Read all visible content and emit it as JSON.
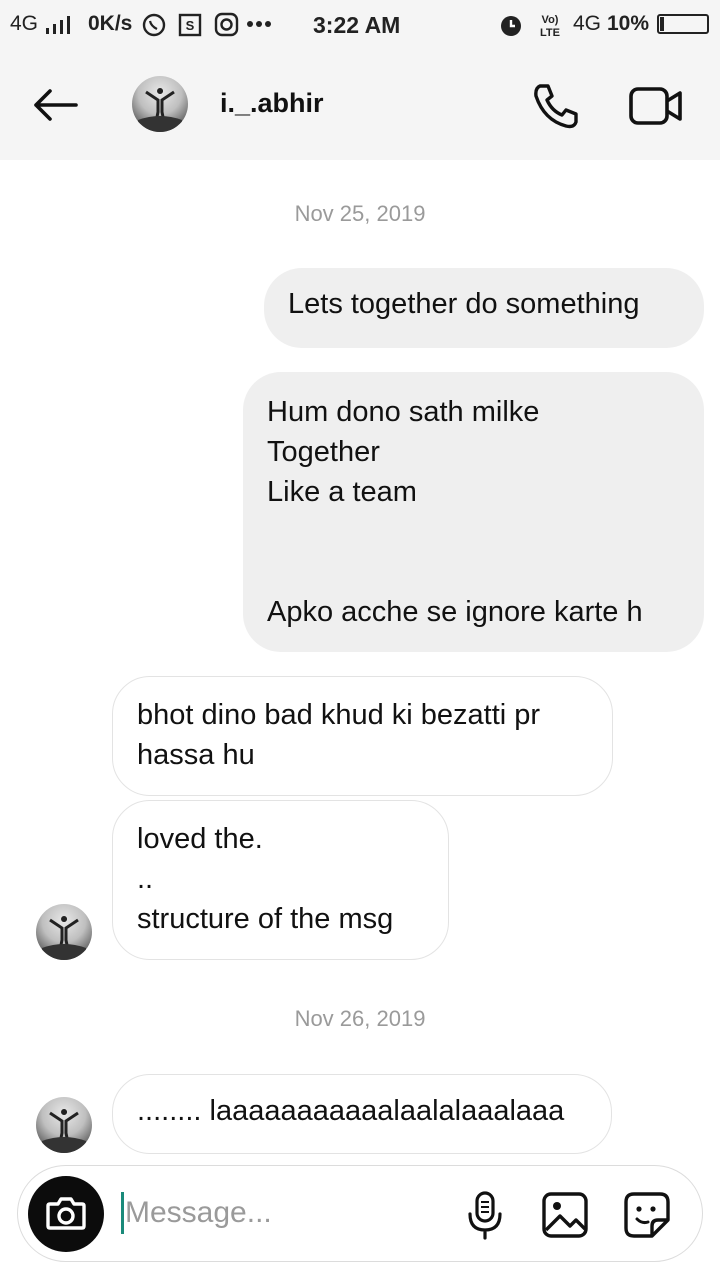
{
  "status_bar": {
    "network": "4G",
    "speed": "0K/s",
    "time": "3:22 AM",
    "network_right": "4G",
    "battery": "10%"
  },
  "header": {
    "username": "i._.abhir"
  },
  "messages": [
    {
      "type": "date",
      "text": "Nov 25, 2019"
    },
    {
      "type": "out",
      "text": "Lets together do something"
    },
    {
      "type": "out",
      "text": "Hum dono sath milke\nTogether\nLike a team\n\n\nApko acche se ignore karte h"
    },
    {
      "type": "in",
      "text": "bhot dino bad khud ki bezatti pr\nhassa hu"
    },
    {
      "type": "in",
      "text": "loved the.\n..\nstructure of the msg"
    },
    {
      "type": "date",
      "text": "Nov 26, 2019"
    },
    {
      "type": "in",
      "text": "........ laaaaaaaaaaalaalalaaalaaa"
    }
  ],
  "composer": {
    "placeholder": "Message..."
  },
  "icons": {
    "back": "arrow-left-icon",
    "call": "phone-icon",
    "video": "video-camera-icon",
    "camera": "camera-icon",
    "mic": "microphone-icon",
    "gallery": "image-icon",
    "sticker": "sticker-icon"
  },
  "colors": {
    "outgoing_bubble": "#efefef",
    "incoming_border": "#e3e3e3",
    "header_bg": "#f5f5f5",
    "cursor": "#1a8a7a"
  }
}
